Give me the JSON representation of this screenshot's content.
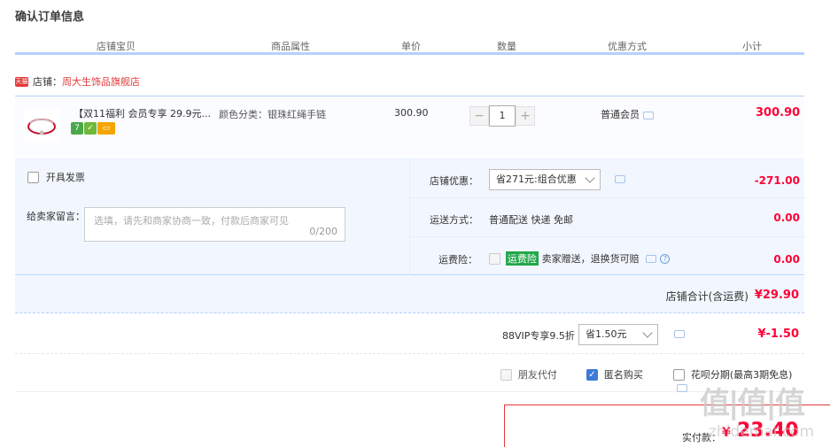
{
  "page": {
    "title": "确认订单信息"
  },
  "columns": [
    "店铺宝贝",
    "商品属性",
    "单价",
    "数量",
    "优惠方式",
    "小计"
  ],
  "shop": {
    "badge": "天猫",
    "label": "店铺：",
    "name": "周大生饰品旗舰店"
  },
  "item": {
    "title": "【双11福利 会员专享 29.9元...",
    "attr": "颜色分类：银珠红绳手链",
    "price": "300.90",
    "qty_minus": "−",
    "qty": "1",
    "qty_plus": "+",
    "discount": "普通会员",
    "subtotal": "300.90",
    "icons": [
      {
        "name": "7day-return-icon",
        "text": "7",
        "color": "#4aa84a"
      },
      {
        "name": "guarantee-icon",
        "text": "✓",
        "color": "#6fb83a"
      },
      {
        "name": "card-icon",
        "text": "▭",
        "color": "#f4a500"
      }
    ]
  },
  "invoice": {
    "label": "开具发票"
  },
  "message": {
    "label": "给卖家留言：",
    "placeholder": "选填，请先和商家协商一致，付款后商家可见",
    "count": "0/200"
  },
  "shop_discount": {
    "label": "店铺优惠：",
    "selected": "省271元:组合优惠",
    "amount": "-271.00"
  },
  "shipping": {
    "label": "运送方式：",
    "value": "普通配送 快递 免邮",
    "amount": "0.00"
  },
  "freight_insurance": {
    "label": "运费险：",
    "tag": "运费险",
    "desc": "卖家赠送，退换货可赔",
    "help": "?",
    "amount": "0.00"
  },
  "shop_total": {
    "label": "店铺合计(含运费)",
    "amount": "¥29.90"
  },
  "vip": {
    "label": "88VIP专享9.5折",
    "selected": "省1.50元",
    "amount": "¥-1.50"
  },
  "pay_options": [
    {
      "label": "朋友代付",
      "checked": false,
      "disabled": true
    },
    {
      "label": "匿名购买",
      "checked": true,
      "disabled": false
    },
    {
      "label": "花呗分期(最高3期免息)",
      "checked": false,
      "disabled": false
    }
  ],
  "total": {
    "label": "实付款：",
    "currency": "¥",
    "amount": "23.40"
  },
  "watermark": {
    "logo": "值|值|值",
    "url": "zhidemai.com"
  }
}
